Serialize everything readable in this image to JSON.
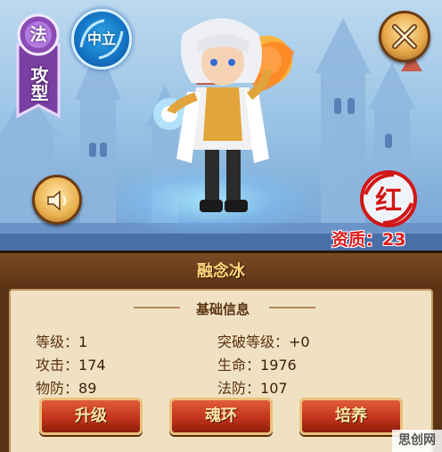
{
  "hero": {
    "class_char": "法",
    "class_type": "攻型",
    "faction": "中立",
    "quality": "红",
    "aptitude_label": "资质：",
    "aptitude_value": "23"
  },
  "panel": {
    "title": "融念冰",
    "section": "基础信息",
    "stats": {
      "level_label": "等级：",
      "level_value": "1",
      "breakthrough_label": "突破等级：",
      "breakthrough_value": "+0",
      "attack_label": "攻击：",
      "attack_value": "174",
      "hp_label": "生命：",
      "hp_value": "1976",
      "pdef_label": "物防：",
      "pdef_value": "89",
      "mdef_label": "法防：",
      "mdef_value": "107"
    },
    "buttons": {
      "upgrade": "升级",
      "soul_ring": "魂环",
      "train": "培养"
    }
  },
  "icons": {
    "close": "close-icon",
    "sound": "speaker-icon"
  },
  "watermark": "思创网"
}
